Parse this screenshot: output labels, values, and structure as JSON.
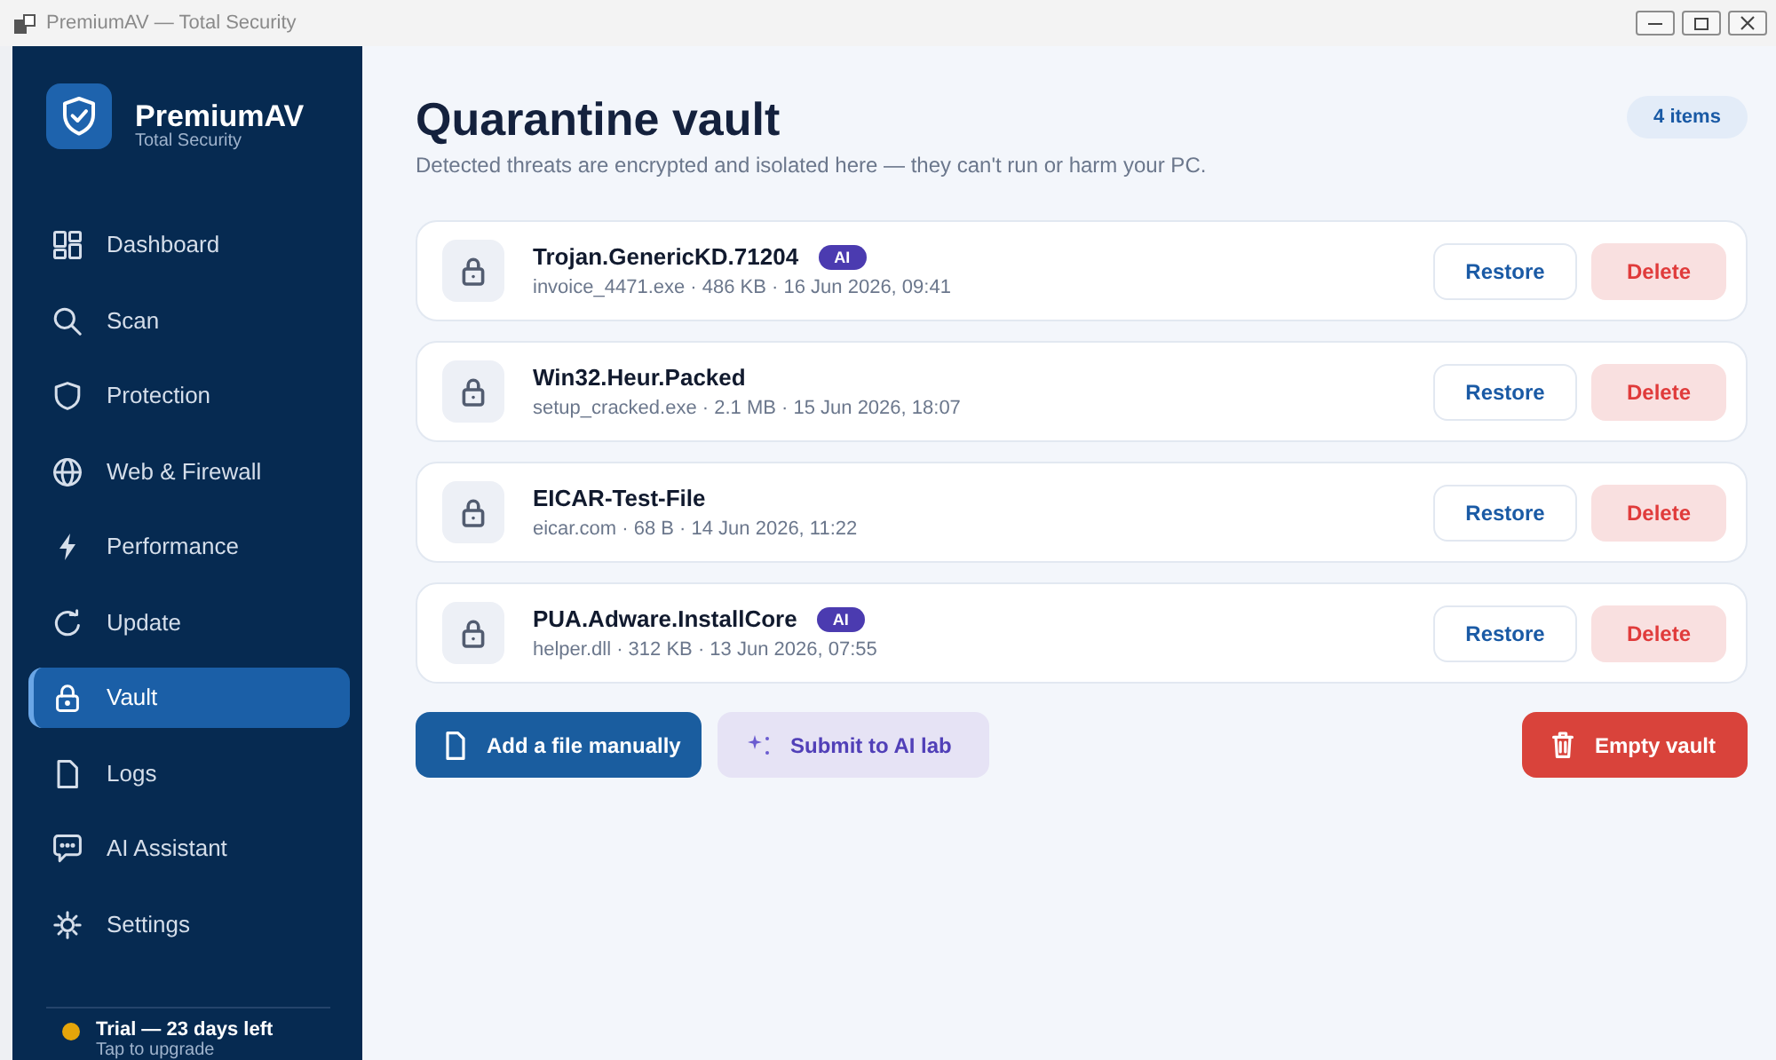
{
  "window": {
    "title": "PremiumAV — Total Security"
  },
  "sidebar": {
    "brand": {
      "name": "PremiumAV",
      "tagline": "Total Security"
    },
    "items": [
      {
        "label": "Dashboard",
        "selected": false
      },
      {
        "label": "Scan",
        "selected": false
      },
      {
        "label": "Protection",
        "selected": false
      },
      {
        "label": "Web & Firewall",
        "selected": false
      },
      {
        "label": "Performance",
        "selected": false
      },
      {
        "label": "Update",
        "selected": false
      },
      {
        "label": "Vault",
        "selected": true
      },
      {
        "label": "Logs",
        "selected": false
      },
      {
        "label": "AI Assistant",
        "selected": false
      },
      {
        "label": "Settings",
        "selected": false
      }
    ],
    "trial": {
      "title": "Trial — 23 days left",
      "subtitle": "Tap to upgrade"
    }
  },
  "header": {
    "title": "Quarantine vault",
    "subtitle": "Detected threats are encrypted and isolated here — they can't run or harm your PC.",
    "count": "4 items"
  },
  "threats": [
    {
      "name": "Trojan.GenericKD.71204",
      "badge": "AI",
      "details": "invoice_4471.exe · 486 KB · 16 Jun 2026, 09:41",
      "buttons": [
        {
          "kind": "restore",
          "label": "Restore"
        },
        {
          "kind": "delete",
          "label": "Delete"
        }
      ]
    },
    {
      "name": "Win32.Heur.Packed",
      "details": "setup_cracked.exe · 2.1 MB · 15 Jun 2026, 18:07",
      "buttons": [
        {
          "kind": "restore",
          "label": "Restore"
        },
        {
          "kind": "delete",
          "label": "Delete"
        }
      ]
    },
    {
      "name": "EICAR-Test-File",
      "details": "eicar.com · 68 B · 14 Jun 2026, 11:22",
      "buttons": [
        {
          "kind": "restore",
          "label": "Restore"
        },
        {
          "kind": "delete",
          "label": "Delete"
        }
      ]
    },
    {
      "name": "PUA.Adware.InstallCore",
      "badge": "AI",
      "details": "helper.dll · 312 KB · 13 Jun 2026, 07:55",
      "buttons": [
        {
          "kind": "restore",
          "label": "Restore"
        },
        {
          "kind": "delete",
          "label": "Delete"
        }
      ]
    }
  ],
  "actions": [
    {
      "kind": "primary",
      "label": "Add a file manually"
    },
    {
      "kind": "ai",
      "label": "Submit to AI lab"
    },
    {
      "kind": "danger",
      "label": "Empty vault"
    }
  ]
}
